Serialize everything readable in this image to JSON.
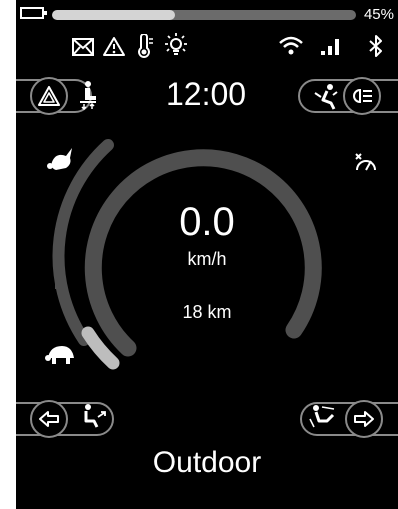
{
  "status_bar": {
    "battery_percent": 45,
    "battery_percent_label": "45%",
    "icons": [
      "battery-icon",
      "mail-icon",
      "warning-icon",
      "thermometer-icon",
      "light-icon",
      "wifi-icon",
      "signal-icon",
      "bluetooth-icon"
    ]
  },
  "clock": "12:00",
  "speedometer": {
    "speed": "0.0",
    "unit": "km/h",
    "distance": "18 km"
  },
  "mode_name": "Outdoor",
  "buttons": {
    "top_left": [
      "hazard-icon",
      "seat-adjust-icon"
    ],
    "top_right": [
      "recline-icon",
      "headlight-icon"
    ],
    "bottom_left": [
      "arrow-left-icon",
      "seat-tilt-icon"
    ],
    "bottom_right": [
      "seat-leg-icon",
      "arrow-right-icon"
    ]
  },
  "speed_range": {
    "fast_icon": "rabbit-icon",
    "slow_icon": "turtle-icon"
  },
  "colors": {
    "background": "#000000",
    "arc": "#4f4f4f",
    "indicator": "#bdbdbd"
  }
}
